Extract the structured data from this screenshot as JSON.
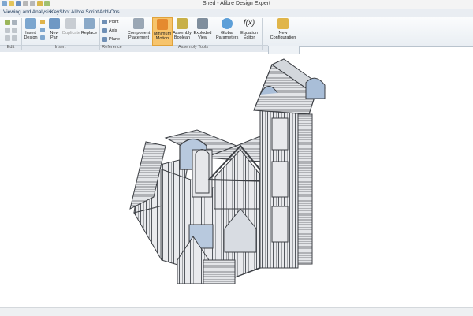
{
  "window": {
    "title": "Shed - Alibre Design Expert"
  },
  "menu": [
    "Viewing and Analysis",
    "KeyShot",
    "Alibre Script",
    "Add-Ons"
  ],
  "ribbon": {
    "groups": [
      "Edit",
      "Insert",
      "Reference",
      "Assembly Tools"
    ],
    "insert_design": "Insert Design",
    "new_part": "New Part",
    "duplicate": "Duplicate",
    "replace": "Replace",
    "point": "Point",
    "axis": "Axis",
    "plane": "Plane",
    "component_placement": "Component Placement",
    "minimum_motion": "Minimum Motion",
    "assembly_boolean": "Assembly Boolean",
    "exploded_view": "Exploded View",
    "global_parameters": "Global Parameters",
    "equation_editor": "Equation Editor",
    "fx_glyph": "f(x)",
    "new_configuration": "New Configuration"
  },
  "colors": {
    "ribbon_active": "#f7c46c",
    "menu_text": "#1f3a5a",
    "model_face": "#c9ccd2",
    "model_edge": "#3c3f44",
    "glass": "#a9bed8"
  }
}
